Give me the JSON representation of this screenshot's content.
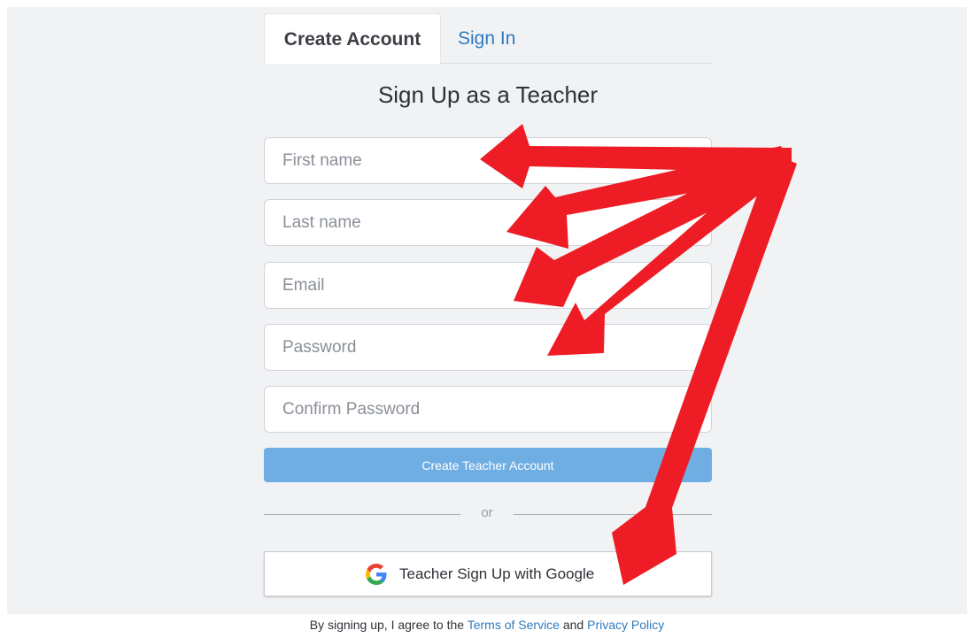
{
  "tabs": {
    "create_account": "Create Account",
    "sign_in": "Sign In"
  },
  "heading": "Sign Up as a Teacher",
  "form": {
    "first_name_placeholder": "First name",
    "last_name_placeholder": "Last name",
    "email_placeholder": "Email",
    "password_placeholder": "Password",
    "confirm_password_placeholder": "Confirm Password",
    "submit_label": "Create Teacher Account"
  },
  "divider_text": "or",
  "google": {
    "label": "Teacher Sign Up with Google",
    "icon": "google-g-icon"
  },
  "terms": {
    "prefix": "By signing up, I agree to the ",
    "tos_link": "Terms of Service",
    "and": " and ",
    "privacy_link": "Privacy Policy"
  },
  "colors": {
    "accent": "#2f7bbf",
    "button_primary": "#6faee3",
    "annotation_arrow": "#ee1c25",
    "panel_background": "#f1f2f4"
  }
}
